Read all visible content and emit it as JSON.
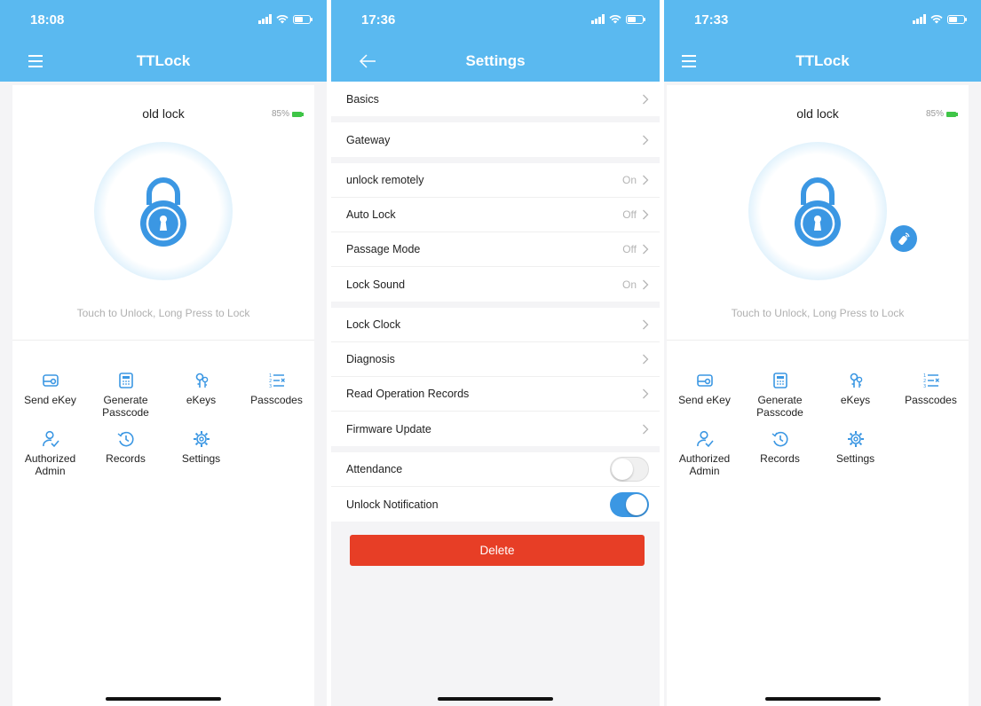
{
  "colors": {
    "primary": "#5ab9f0",
    "accent": "#3b97e3",
    "danger": "#e73e26",
    "battery": "#3fc547"
  },
  "screens": [
    {
      "status_time": "18:08",
      "title": "TTLock",
      "lock_name": "old lock",
      "battery": "85%",
      "hint": "Touch to Unlock, Long Press to Lock",
      "menu": [
        {
          "label": "Send eKey",
          "icon": "send-ekey-icon"
        },
        {
          "label": "Generate Passcode",
          "icon": "generate-passcode-icon"
        },
        {
          "label": "eKeys",
          "icon": "ekeys-icon"
        },
        {
          "label": "Passcodes",
          "icon": "passcodes-icon"
        },
        {
          "label": "Authorized Admin",
          "icon": "authorized-admin-icon"
        },
        {
          "label": "Records",
          "icon": "records-icon"
        },
        {
          "label": "Settings",
          "icon": "settings-gear-icon"
        }
      ]
    },
    {
      "status_time": "17:36",
      "title": "Settings",
      "groups": [
        [
          {
            "label": "Basics",
            "value": ""
          }
        ],
        [
          {
            "label": "Gateway",
            "value": ""
          }
        ],
        [
          {
            "label": "unlock remotely",
            "value": "On"
          },
          {
            "label": "Auto Lock",
            "value": "Off"
          },
          {
            "label": "Passage Mode",
            "value": "Off"
          },
          {
            "label": "Lock Sound",
            "value": "On"
          }
        ],
        [
          {
            "label": "Lock Clock",
            "value": ""
          },
          {
            "label": "Diagnosis",
            "value": ""
          },
          {
            "label": "Read Operation Records",
            "value": ""
          },
          {
            "label": "Firmware Update",
            "value": ""
          }
        ]
      ],
      "toggles": [
        {
          "label": "Attendance",
          "on": false
        },
        {
          "label": "Unlock Notification",
          "on": true
        }
      ],
      "delete_label": "Delete"
    },
    {
      "status_time": "17:33",
      "title": "TTLock",
      "lock_name": "old lock",
      "battery": "85%",
      "hint": "Touch to Unlock, Long Press to Lock",
      "menu": [
        {
          "label": "Send eKey",
          "icon": "send-ekey-icon"
        },
        {
          "label": "Generate Passcode",
          "icon": "generate-passcode-icon"
        },
        {
          "label": "eKeys",
          "icon": "ekeys-icon"
        },
        {
          "label": "Passcodes",
          "icon": "passcodes-icon"
        },
        {
          "label": "Authorized Admin",
          "icon": "authorized-admin-icon"
        },
        {
          "label": "Records",
          "icon": "records-icon"
        },
        {
          "label": "Settings",
          "icon": "settings-gear-icon"
        }
      ]
    }
  ]
}
